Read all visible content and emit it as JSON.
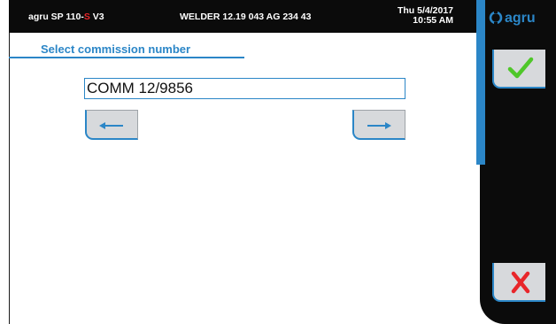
{
  "header": {
    "model_prefix": "agru SP 110-",
    "model_red": "S",
    "model_suffix": " V3",
    "welder": "WELDER 12.19 043 AG 234 43",
    "date": "Thu 5/4/2017",
    "time": "10:55 AM"
  },
  "brand": {
    "logo_text": "agru",
    "logo_color": "#2b86c7"
  },
  "main": {
    "title": "Select commission number",
    "commission_value": "COMM 12/9856",
    "prev_icon": "arrow-left-icon",
    "next_icon": "arrow-right-icon"
  },
  "sidebar": {
    "confirm_icon": "checkmark-icon",
    "cancel_icon": "x-icon"
  },
  "colors": {
    "accent": "#2b86c7",
    "header_bg": "#0b0b0b",
    "button_bg": "#d7d9dc",
    "confirm": "#4fc72a",
    "cancel": "#e8262a"
  }
}
